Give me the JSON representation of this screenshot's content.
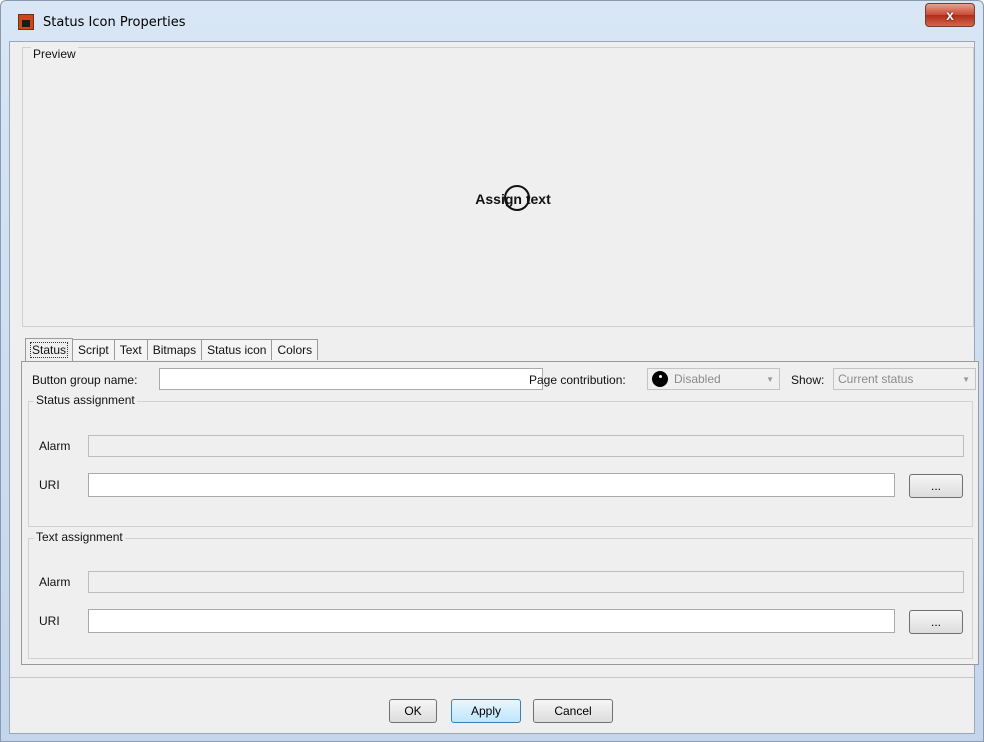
{
  "window": {
    "title": "Status Icon Properties",
    "close_label": "x"
  },
  "preview": {
    "label": "Preview",
    "sample_text": "Assign text"
  },
  "tabs": [
    {
      "label": "Status",
      "active": true
    },
    {
      "label": "Script"
    },
    {
      "label": "Text"
    },
    {
      "label": "Bitmaps"
    },
    {
      "label": "Status icon"
    },
    {
      "label": "Colors"
    }
  ],
  "status_tab": {
    "button_group_label": "Button group name:",
    "button_group_value": "",
    "page_contribution_label": "Page contribution:",
    "page_contribution_value": "Disabled",
    "show_label": "Show:",
    "show_value": "Current status",
    "status_assignment": {
      "label": "Status assignment",
      "alarm_label": "Alarm",
      "alarm_value": "",
      "uri_label": "URI",
      "uri_value": "",
      "browse_label": "..."
    },
    "text_assignment": {
      "label": "Text assignment",
      "alarm_label": "Alarm",
      "alarm_value": "",
      "uri_label": "URI",
      "uri_value": "",
      "browse_label": "..."
    }
  },
  "buttons": {
    "ok": "OK",
    "apply": "Apply",
    "cancel": "Cancel"
  }
}
